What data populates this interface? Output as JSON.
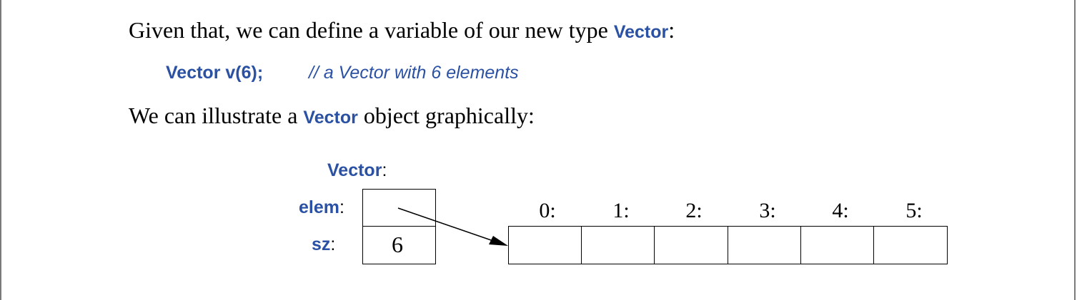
{
  "paragraph1": {
    "text_before": "Given that, we can define a variable of our new type ",
    "code": "Vector",
    "text_after": ":"
  },
  "code_line": {
    "statement": "Vector v(6);",
    "comment": "// a Vector with 6 elements"
  },
  "paragraph2": {
    "text_before": "We can illustrate a ",
    "code": "Vector",
    "text_after": " object graphically:"
  },
  "diagram": {
    "type_label": "Vector",
    "type_label_suffix": ":",
    "fields": [
      {
        "name": "elem",
        "suffix": ":",
        "value": ""
      },
      {
        "name": "sz",
        "suffix": ":",
        "value": "6"
      }
    ],
    "array_indices": [
      "0:",
      "1:",
      "2:",
      "3:",
      "4:",
      "5:"
    ]
  }
}
